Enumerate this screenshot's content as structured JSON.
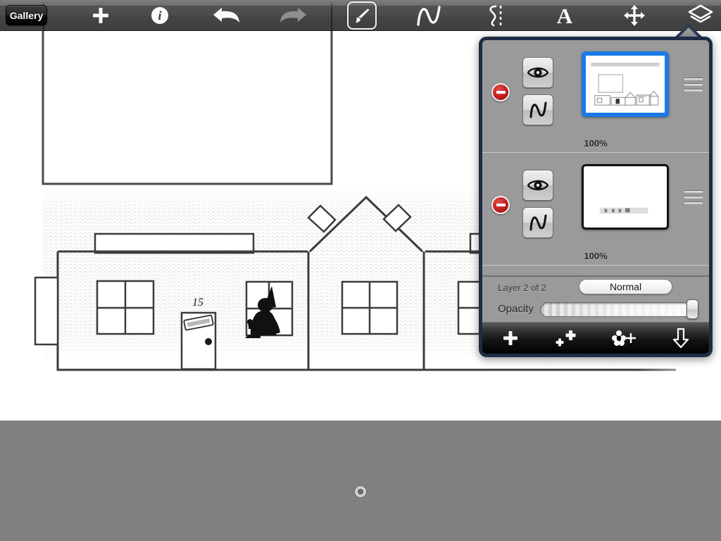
{
  "app": {
    "name": "Sketch drawing app",
    "accent_blue": "#1a7ae8",
    "popover_border": "#1e2c45",
    "delete_red": "#c01f1f",
    "panel_gray": "#9a9a9a",
    "toolbar_dark": "#4a4a4a",
    "workspace_gray": "#808080"
  },
  "toolbar": {
    "gallery_label": "Gallery",
    "items": [
      {
        "name": "add-icon",
        "label": "Add",
        "state": "enabled"
      },
      {
        "name": "info-icon",
        "label": "Info",
        "state": "enabled"
      },
      {
        "name": "undo-icon",
        "label": "Undo",
        "state": "enabled"
      },
      {
        "name": "redo-icon",
        "label": "Redo",
        "state": "disabled"
      },
      {
        "name": "brush-icon",
        "label": "Brush",
        "state": "selected"
      },
      {
        "name": "smooth-icon",
        "label": "Smooth",
        "state": "enabled"
      },
      {
        "name": "cut-icon",
        "label": "Cut",
        "state": "enabled"
      },
      {
        "name": "text-icon",
        "label": "Text",
        "state": "enabled"
      },
      {
        "name": "transform-icon",
        "label": "Transform",
        "state": "enabled"
      },
      {
        "name": "layers-icon",
        "label": "Layers",
        "state": "active"
      }
    ]
  },
  "canvas": {
    "description": "Pencil-sketch architectural elevation of a row of houses with a gabled roof, windows and a door; an empty rectangle outline sits above; a silhouette figure stands in the left window.",
    "door_number": "15",
    "background": "#ffffff"
  },
  "status": {
    "spinner_name": "loading-spinner",
    "visible": true
  },
  "layers_popover": {
    "title": "Layers",
    "rows": [
      {
        "index": 1,
        "thumbnail_alt": "Houses elevation sketch",
        "opacity_label": "100%",
        "selected": true,
        "visible": true,
        "delete_name": "delete-layer-button",
        "eye_name": "layer-visibility-button",
        "alpha_name": "alpha-lock-button",
        "grip_name": "layer-drag-handle"
      },
      {
        "index": 2,
        "thumbnail_alt": "Mostly blank layer with faint marks",
        "opacity_label": "100%",
        "selected": false,
        "visible": true,
        "delete_name": "delete-layer-button",
        "eye_name": "layer-visibility-button",
        "alpha_name": "alpha-lock-button",
        "grip_name": "layer-drag-handle"
      }
    ],
    "settings": {
      "layer_count_label": "Layer 2 of 2",
      "blend_mode": "Normal",
      "opacity_label": "Opacity",
      "opacity_value": 100
    },
    "actions": [
      {
        "name": "add-layer-button",
        "label": "Add layer"
      },
      {
        "name": "duplicate-layer-button",
        "label": "Duplicate layer"
      },
      {
        "name": "merge-layers-button",
        "label": "Merge layers"
      },
      {
        "name": "merge-down-button",
        "label": "Merge down"
      }
    ]
  }
}
